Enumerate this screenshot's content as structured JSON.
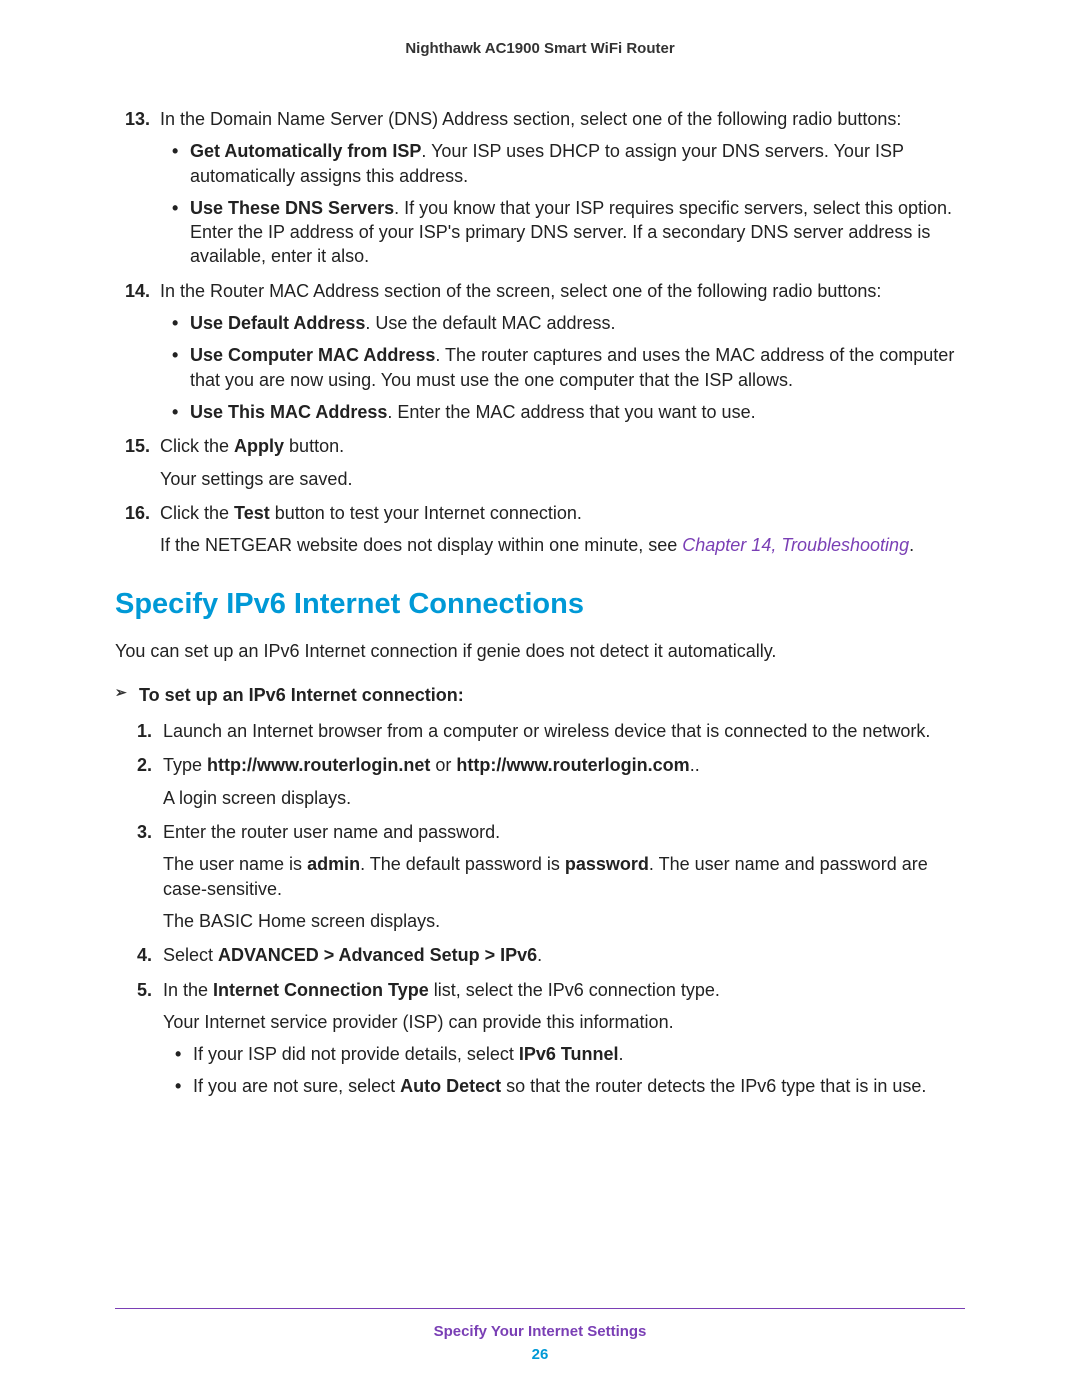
{
  "header": "Nighthawk AC1900 Smart WiFi Router",
  "top_list": [
    {
      "num": "13.",
      "text": "In the Domain Name Server (DNS) Address section, select one of the following radio buttons:",
      "bullets": [
        {
          "bold": "Get Automatically from ISP",
          "rest": ". Your ISP uses DHCP to assign your DNS servers. Your ISP automatically assigns this address."
        },
        {
          "bold": "Use These DNS Servers",
          "rest": ". If you know that your ISP requires specific servers, select this option. Enter the IP address of your ISP's primary DNS server. If a secondary DNS server address is available, enter it also."
        }
      ]
    },
    {
      "num": "14.",
      "text": "In the Router MAC Address section of the screen, select one of the following radio buttons:",
      "bullets": [
        {
          "bold": "Use Default Address",
          "rest": ". Use the default MAC address."
        },
        {
          "bold": "Use Computer MAC Address",
          "rest": ". The router captures and uses the MAC address of the computer that you are now using. You must use the one computer that the ISP allows."
        },
        {
          "bold": "Use This MAC Address",
          "rest": ". Enter the MAC address that you want to use."
        }
      ]
    },
    {
      "num": "15.",
      "text_parts": {
        "pre": "Click the ",
        "bold": "Apply",
        "post": " button."
      },
      "para": "Your settings are saved."
    },
    {
      "num": "16.",
      "text_parts": {
        "pre": "Click the ",
        "bold": "Test",
        "post": " button to test your Internet connection."
      },
      "para_pre": "If the NETGEAR website does not display within one minute, see ",
      "para_link": "Chapter 14, Troubleshooting",
      "para_post": "."
    }
  ],
  "section_title": "Specify IPv6 Internet Connections",
  "section_intro": "You can set up an IPv6 Internet connection if genie does not detect it automatically.",
  "procedure_title": "To set up an IPv6 Internet connection:",
  "steps": [
    {
      "num": "1.",
      "text": "Launch an Internet browser from a computer or wireless device that is connected to the network."
    },
    {
      "num": "2.",
      "text_parts": {
        "pre": "Type ",
        "bold": "http://www.routerlogin.net",
        "mid": " or ",
        "bold2": "http://www.routerlogin.com",
        "post": ".."
      },
      "para": "A login screen displays."
    },
    {
      "num": "3.",
      "text": "Enter the router user name and password.",
      "para_parts": {
        "p1": "The user name is ",
        "b1": "admin",
        "p2": ". The default password is ",
        "b2": "password",
        "p3": ". The user name and password are case-sensitive."
      },
      "para2": "The BASIC Home screen displays."
    },
    {
      "num": "4.",
      "text_parts": {
        "pre": "Select ",
        "bold": "ADVANCED > Advanced Setup > IPv6",
        "post": "."
      }
    },
    {
      "num": "5.",
      "text_parts": {
        "pre": "In the ",
        "bold": "Internet Connection Type",
        "post": " list, select the IPv6 connection type."
      },
      "para": "Your Internet service provider (ISP) can provide this information.",
      "bullets": [
        {
          "pre": "If your ISP did not provide details, select ",
          "bold": "IPv6 Tunnel",
          "post": "."
        },
        {
          "pre": "If you are not sure, select ",
          "bold": "Auto Detect",
          "post": " so that the router detects the IPv6 type that is in use."
        }
      ]
    }
  ],
  "footer_text": "Specify Your Internet Settings",
  "footer_page": "26"
}
